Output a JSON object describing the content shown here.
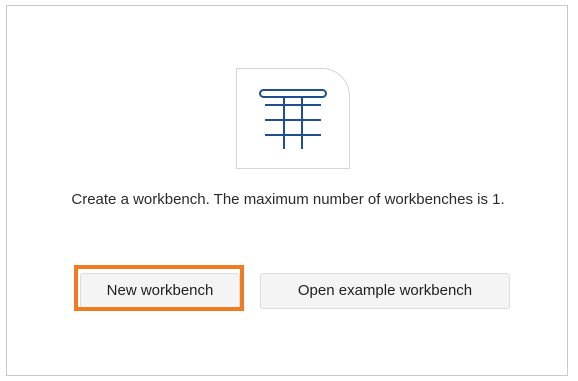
{
  "empty_state": {
    "message": "Create a workbench. The maximum number of workbenches is 1.",
    "illustration_icon": "table-grid-icon"
  },
  "actions": {
    "new_workbench_label": "New workbench",
    "open_example_label": "Open example workbench"
  },
  "colors": {
    "icon_stroke": "#1f4f8f",
    "highlight_border": "#f27a20",
    "button_bg": "#f4f4f4",
    "panel_border": "#c9c9c9"
  }
}
